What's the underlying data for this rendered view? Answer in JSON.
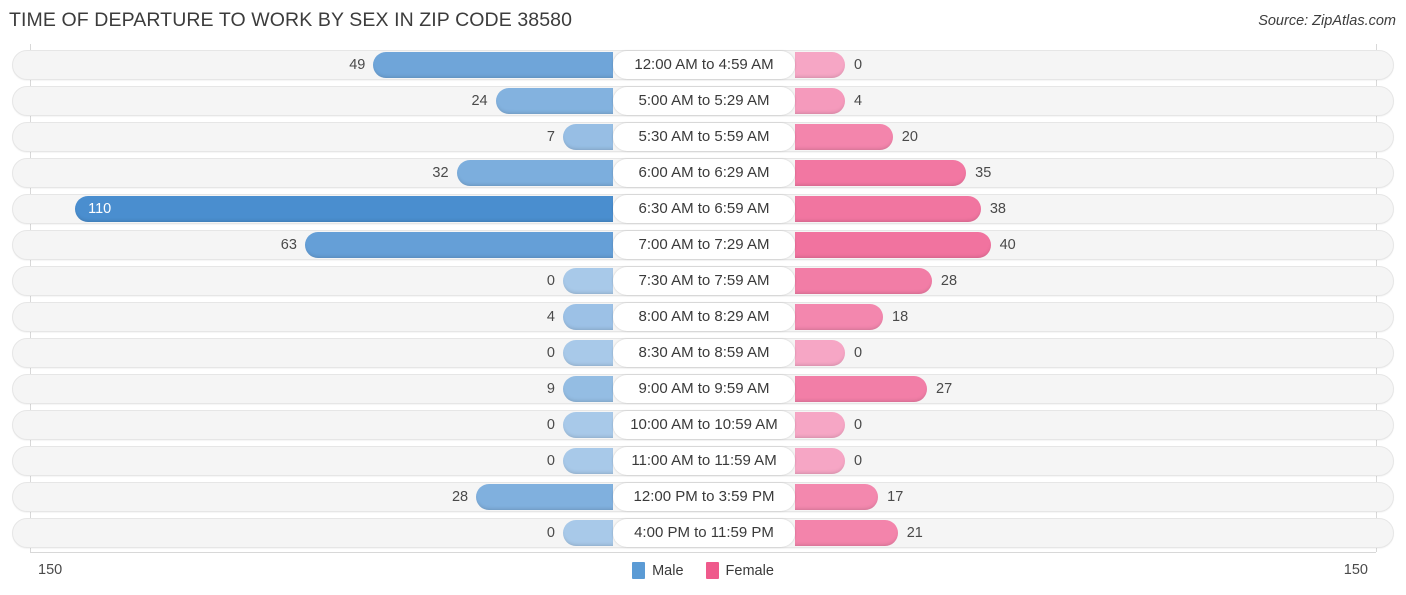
{
  "header": {
    "title": "TIME OF DEPARTURE TO WORK BY SEX IN ZIP CODE 38580",
    "source": "Source: ZipAtlas.com"
  },
  "footer": {
    "axis_left": "150",
    "axis_right": "150",
    "legend": [
      {
        "label": "Male",
        "color": "#5b9bd5"
      },
      {
        "label": "Female",
        "color": "#ef5a8c"
      }
    ]
  },
  "chart_data": {
    "type": "bar",
    "subtype": "diverging-bidirectional",
    "title": "TIME OF DEPARTURE TO WORK BY SEX IN ZIP CODE 38580",
    "xlabel": "",
    "ylabel": "",
    "xlim": [
      -150,
      150
    ],
    "axis_max": 150,
    "grid": false,
    "legend_position": "bottom-center",
    "categories": [
      "12:00 AM to 4:59 AM",
      "5:00 AM to 5:29 AM",
      "5:30 AM to 5:59 AM",
      "6:00 AM to 6:29 AM",
      "6:30 AM to 6:59 AM",
      "7:00 AM to 7:29 AM",
      "7:30 AM to 7:59 AM",
      "8:00 AM to 8:29 AM",
      "8:30 AM to 8:59 AM",
      "9:00 AM to 9:59 AM",
      "10:00 AM to 10:59 AM",
      "11:00 AM to 11:59 AM",
      "12:00 PM to 3:59 PM",
      "4:00 PM to 11:59 PM"
    ],
    "series": [
      {
        "name": "Male",
        "color": "#5b9bd5",
        "side": "left",
        "values": [
          49,
          24,
          7,
          32,
          110,
          63,
          0,
          4,
          0,
          9,
          0,
          0,
          28,
          0
        ]
      },
      {
        "name": "Female",
        "color": "#ef5a8c",
        "side": "right",
        "values": [
          0,
          4,
          20,
          35,
          38,
          40,
          28,
          18,
          0,
          27,
          0,
          0,
          17,
          21
        ]
      }
    ]
  }
}
